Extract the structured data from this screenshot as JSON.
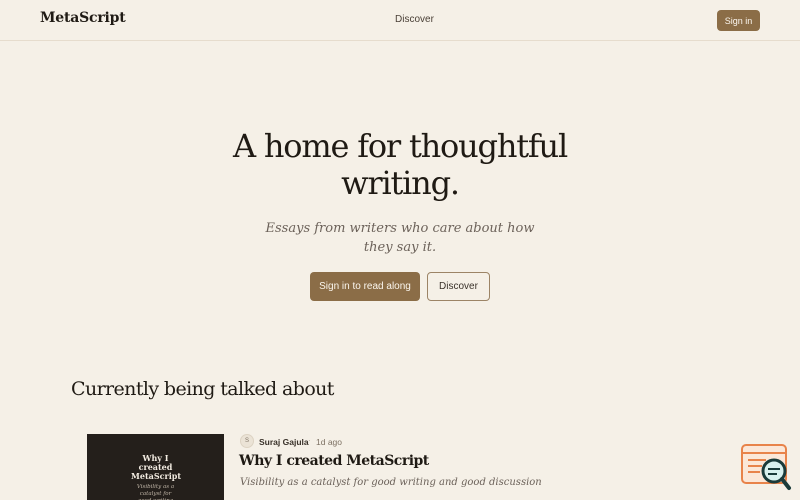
{
  "header": {
    "logo": "MetaScript",
    "nav_discover": "Discover",
    "signin_label": "Sign in"
  },
  "hero": {
    "title": "A home for thoughtful writing.",
    "subtitle": "Essays from writers who care about how they say it.",
    "primary_cta": "Sign in to read along",
    "secondary_cta": "Discover"
  },
  "trending": {
    "heading": "Currently being talked about",
    "articles": [
      {
        "thumb_title": "Why I created MetaScript",
        "thumb_subtitle": "Visibility as a catalyst for good writing and good discussion",
        "avatar_initial": "S",
        "author": "Suraj Gajula",
        "separator": "·",
        "age": "1d ago",
        "title": "Why I created MetaScript",
        "description": "Visibility as a catalyst for good writing and good discussion"
      }
    ]
  },
  "icons": {
    "widget": "browser-search-icon"
  },
  "colors": {
    "background": "#f5f0e7",
    "accent": "#8b6d47",
    "text": "#1f1a14",
    "muted": "#6c625a",
    "widget": "#e8834a"
  }
}
